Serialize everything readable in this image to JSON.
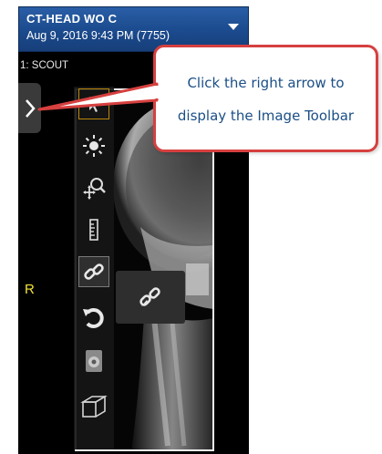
{
  "header": {
    "study_title": "CT-HEAD WO C",
    "study_date": "Aug 9, 2016 9:43 PM (7755)",
    "dropdown_icon": "chevron-down-icon"
  },
  "viewer": {
    "series_label": "1: SCOUT",
    "orientation_marker": "R",
    "marker_color": "#f2e23a"
  },
  "sidebar": {
    "expand_icon": "chevron-right-icon"
  },
  "toolbar": {
    "tools": [
      {
        "name": "pointer-tool",
        "icon": "cursor-icon",
        "state": "highlighted"
      },
      {
        "name": "window-level-tool",
        "icon": "brightness-icon"
      },
      {
        "name": "zoom-pan-tool",
        "icon": "zoom-pan-icon"
      },
      {
        "name": "measure-tool",
        "icon": "ruler-icon"
      },
      {
        "name": "link-tool",
        "icon": "link-icon",
        "state": "selected"
      },
      {
        "name": "rotate-tool",
        "icon": "rotate-icon"
      },
      {
        "name": "cine-tool",
        "icon": "cine-icon"
      },
      {
        "name": "3d-tool",
        "icon": "cube-icon"
      }
    ],
    "flyout_icon": "unlink-icon"
  },
  "callout": {
    "line1": "Click the right arrow to",
    "line2": "display the Image Toolbar",
    "border_color": "#d6403f",
    "text_color": "#1b4f86"
  }
}
